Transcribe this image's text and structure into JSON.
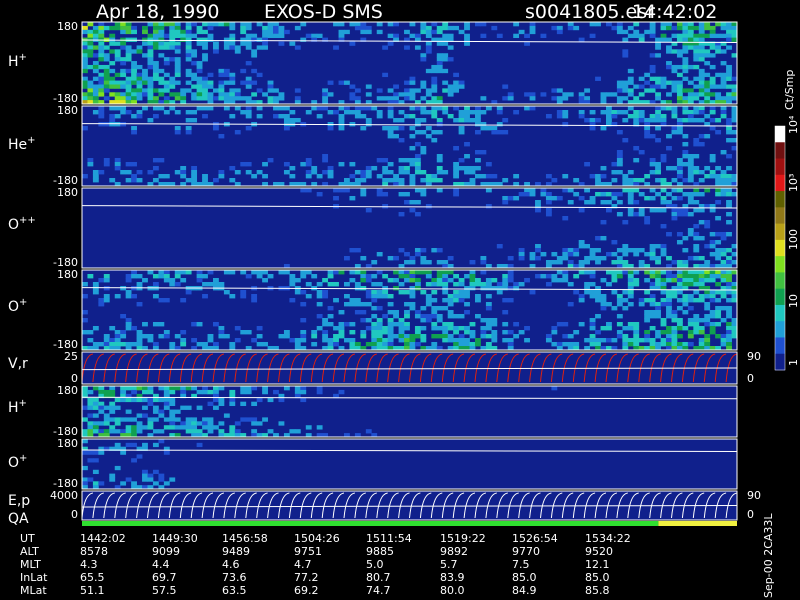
{
  "header": {
    "date": "Apr 18, 1990",
    "instrument": "EXOS-D SMS",
    "file": "s0041805.esr",
    "time": "14:42:02"
  },
  "colors": {
    "background": "#000000",
    "plot_fill": "#10208c",
    "frame": "#ffffff",
    "vel_trace": "#e02010",
    "qa_green": "#30e030",
    "qa_yellow": "#f0f040"
  },
  "chart_data": {
    "type": "heatmap",
    "colorbar": {
      "label": "Ct/Smp",
      "ticks": [
        "1",
        "10",
        "100",
        "10³",
        "10⁴"
      ],
      "scale": "log",
      "colors": [
        "#10208c",
        "#1f50d0",
        "#20a0d8",
        "#20c8c0",
        "#10a050",
        "#40c040",
        "#80e020",
        "#e0e020",
        "#b8a018",
        "#907818",
        "#606000",
        "#e01818",
        "#a01010",
        "#701010",
        "#ffffff"
      ]
    },
    "panels": [
      {
        "id": "h-plus",
        "label_base": "H",
        "label_sup": "+",
        "ymax": "180",
        "ymin": "-180",
        "levels": [
          [
            0,
            3.0
          ],
          [
            0.05,
            2.5
          ],
          [
            0.2,
            1.5
          ],
          [
            0.35,
            0.9
          ],
          [
            0.5,
            1.0
          ],
          [
            0.55,
            1.6
          ],
          [
            0.6,
            0.8
          ],
          [
            0.8,
            0.9
          ],
          [
            0.92,
            2.0
          ],
          [
            1,
            2.0
          ]
        ]
      },
      {
        "id": "he-plus",
        "label_base": "He",
        "label_sup": "+",
        "ymax": "180",
        "ymin": "-180",
        "levels": [
          [
            0,
            1.0
          ],
          [
            0.45,
            1.0
          ],
          [
            0.5,
            1.5
          ],
          [
            0.6,
            1.2
          ],
          [
            0.7,
            0.7
          ],
          [
            0.9,
            1.4
          ],
          [
            1,
            1.5
          ]
        ]
      },
      {
        "id": "o-pp",
        "label_base": "O",
        "label_sup": "++",
        "ymax": "180",
        "ymin": "-180",
        "levels": [
          [
            0,
            0.5
          ],
          [
            0.3,
            0.6
          ],
          [
            0.5,
            1.0
          ],
          [
            0.6,
            0.8
          ],
          [
            0.9,
            1.4
          ],
          [
            1,
            1.4
          ]
        ]
      },
      {
        "id": "o-plus",
        "label_base": "O",
        "label_sup": "+",
        "ymax": "180",
        "ymin": "-180",
        "levels": [
          [
            0,
            1.2
          ],
          [
            0.3,
            1.0
          ],
          [
            0.5,
            2.0
          ],
          [
            0.6,
            1.6
          ],
          [
            0.7,
            0.8
          ],
          [
            0.9,
            2.2
          ],
          [
            1,
            2.2
          ]
        ]
      },
      {
        "id": "vr",
        "label_base": "V,r",
        "label_sup": "",
        "ymax": "25",
        "ymin": "0",
        "right_top": "90",
        "right_bottom": "0"
      },
      {
        "id": "h-plus-2",
        "label_base": "H",
        "label_sup": "+",
        "ymax": "180",
        "ymin": "-180",
        "levels": [
          [
            0,
            2.0
          ],
          [
            0.2,
            1.5
          ],
          [
            0.3,
            1.0
          ],
          [
            0.5,
            0.6
          ],
          [
            1,
            0.6
          ]
        ]
      },
      {
        "id": "o-plus-2",
        "label_base": "O",
        "label_sup": "+",
        "ymax": "180",
        "ymin": "-180",
        "levels": [
          [
            0,
            1.5
          ],
          [
            0.1,
            1.0
          ],
          [
            0.2,
            0.6
          ],
          [
            1,
            0.5
          ]
        ]
      },
      {
        "id": "ep",
        "label_base": "E,p",
        "label_sup": "",
        "ymax": "4000",
        "ymin": "0",
        "right_top": "90",
        "right_bottom": "0"
      },
      {
        "id": "qa",
        "label_base": "QA",
        "label_sup": "",
        "qa_green_until": 0.88
      }
    ],
    "table": {
      "rows": [
        {
          "label": "UT",
          "values": [
            "1442:02",
            "1449:30",
            "1456:58",
            "1504:26",
            "1511:54",
            "1519:22",
            "1526:54",
            "1534:22"
          ]
        },
        {
          "label": "ALT",
          "values": [
            "8578",
            "9099",
            "9489",
            "9751",
            "9885",
            "9892",
            "9770",
            "9520"
          ]
        },
        {
          "label": "MLT",
          "values": [
            "4.3",
            "4.4",
            "4.6",
            "4.7",
            "5.0",
            "5.7",
            "7.5",
            "12.1"
          ]
        },
        {
          "label": "InLat",
          "values": [
            "65.5",
            "69.7",
            "73.6",
            "77.2",
            "80.7",
            "83.9",
            "85.0",
            "85.0"
          ]
        },
        {
          "label": "MLat",
          "values": [
            "51.1",
            "57.5",
            "63.5",
            "69.2",
            "74.7",
            "80.0",
            "84.9",
            "85.8"
          ]
        }
      ]
    },
    "side_note": "Sep-00 2CA33L"
  }
}
